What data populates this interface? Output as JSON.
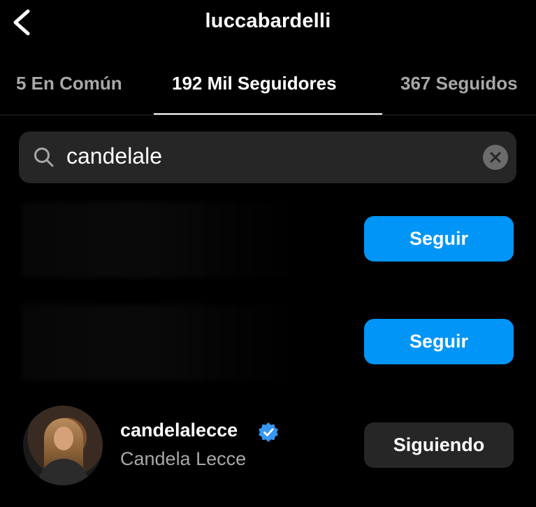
{
  "header": {
    "title": "luccabardelli"
  },
  "tabs": [
    {
      "label": "5 En Común",
      "active": false
    },
    {
      "label": "192 Mil Seguidores",
      "active": true
    },
    {
      "label": "367 Seguidos",
      "active": false
    }
  ],
  "search": {
    "value": "candelale"
  },
  "results": [
    {
      "button_label": "Seguir"
    },
    {
      "button_label": "Seguir"
    },
    {
      "username": "candelalecce",
      "full_name": "Candela Lecce",
      "verified": true,
      "button_label": "Siguiendo"
    }
  ],
  "colors": {
    "background": "#000000",
    "accent": "#0095f6",
    "verified_badge": "#3897f0",
    "secondary_button": "#262626",
    "secondary_text": "#a8a8a8"
  },
  "icons": {
    "back": "chevron-left-icon",
    "search": "search-icon",
    "clear": "close-icon",
    "verified": "verified-badge-icon"
  }
}
